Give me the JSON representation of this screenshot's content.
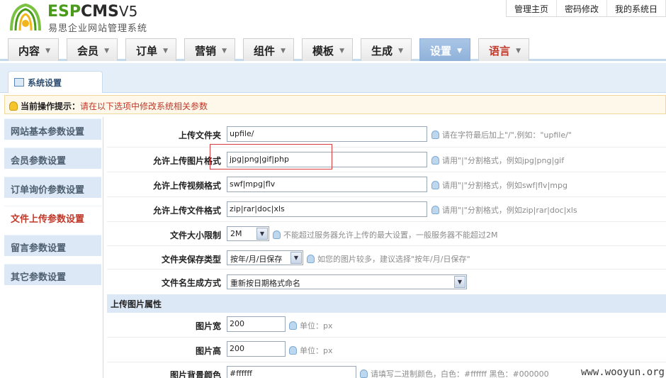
{
  "header": {
    "brand_green": "ESP",
    "brand_dark": "CMS",
    "brand_version": "V5",
    "subtitle": "易思企业网站管理系统",
    "top_links": [
      "管理主页",
      "密码修改",
      "我的系统日"
    ]
  },
  "nav": {
    "items": [
      {
        "label": "内容"
      },
      {
        "label": "会员"
      },
      {
        "label": "订单"
      },
      {
        "label": "营销"
      },
      {
        "label": "组件"
      },
      {
        "label": "模板"
      },
      {
        "label": "生成"
      },
      {
        "label": "设置",
        "active": true
      },
      {
        "label": "语言"
      }
    ],
    "arrow": "▼"
  },
  "tab": {
    "label": "系统设置"
  },
  "tip": {
    "label": "当前操作提示：",
    "text": "请在以下选项中修改系统相关参数"
  },
  "sidebar": {
    "items": [
      {
        "label": "网站基本参数设置"
      },
      {
        "label": "会员参数设置"
      },
      {
        "label": "订单询价参数设置"
      },
      {
        "label": "文件上传参数设置",
        "active": true
      },
      {
        "label": "留言参数设置"
      },
      {
        "label": "其它参数设置"
      }
    ]
  },
  "form": {
    "upload_dir": {
      "label": "上传文件夹",
      "value": "upfile/",
      "hint": "请在字符最后加上\"/\",例如：\"upfile/\""
    },
    "img_types": {
      "label": "允许上传图片格式",
      "value": "jpg|png|gif|php",
      "hint": "请用\"|\"分割格式，例如jpg|png|gif"
    },
    "video_types": {
      "label": "允许上传视频格式",
      "value": "swf|mpg|flv",
      "hint": "请用\"|\"分割格式，例如swf|flv|mpg"
    },
    "file_types": {
      "label": "允许上传文件格式",
      "value": "zip|rar|doc|xls",
      "hint": "请用\"|\"分割格式，例如zip|rar|doc|xls"
    },
    "size_limit": {
      "label": "文件大小限制",
      "value": "2M",
      "hint": "不能超过服务器允许上传的最大设置，一般服务器不能超过2M"
    },
    "save_type": {
      "label": "文件夹保存类型",
      "value": "按年/月/日保存",
      "hint": "如您的图片较多，建议选择\"按年/月/日保存\""
    },
    "name_mode": {
      "label": "文件名生成方式",
      "value": "重新按日期格式命名"
    },
    "section_title": "上传图片属性",
    "img_width": {
      "label": "图片宽",
      "value": "200",
      "hint": "单位：px"
    },
    "img_height": {
      "label": "图片高",
      "value": "200",
      "hint": "单位：px"
    },
    "img_bg": {
      "label": "图片背景颜色",
      "value": "#ffffff",
      "hint": "请填写二进制颜色，白色：#ffffff 黑色：#000000"
    }
  },
  "watermark": "www.wooyun.org",
  "colors": {
    "brand_green": "#4a9a1c",
    "nav_active": "#8fb1d9",
    "accent_red": "#c0392b",
    "sidebar_bg": "#dce8f5"
  }
}
